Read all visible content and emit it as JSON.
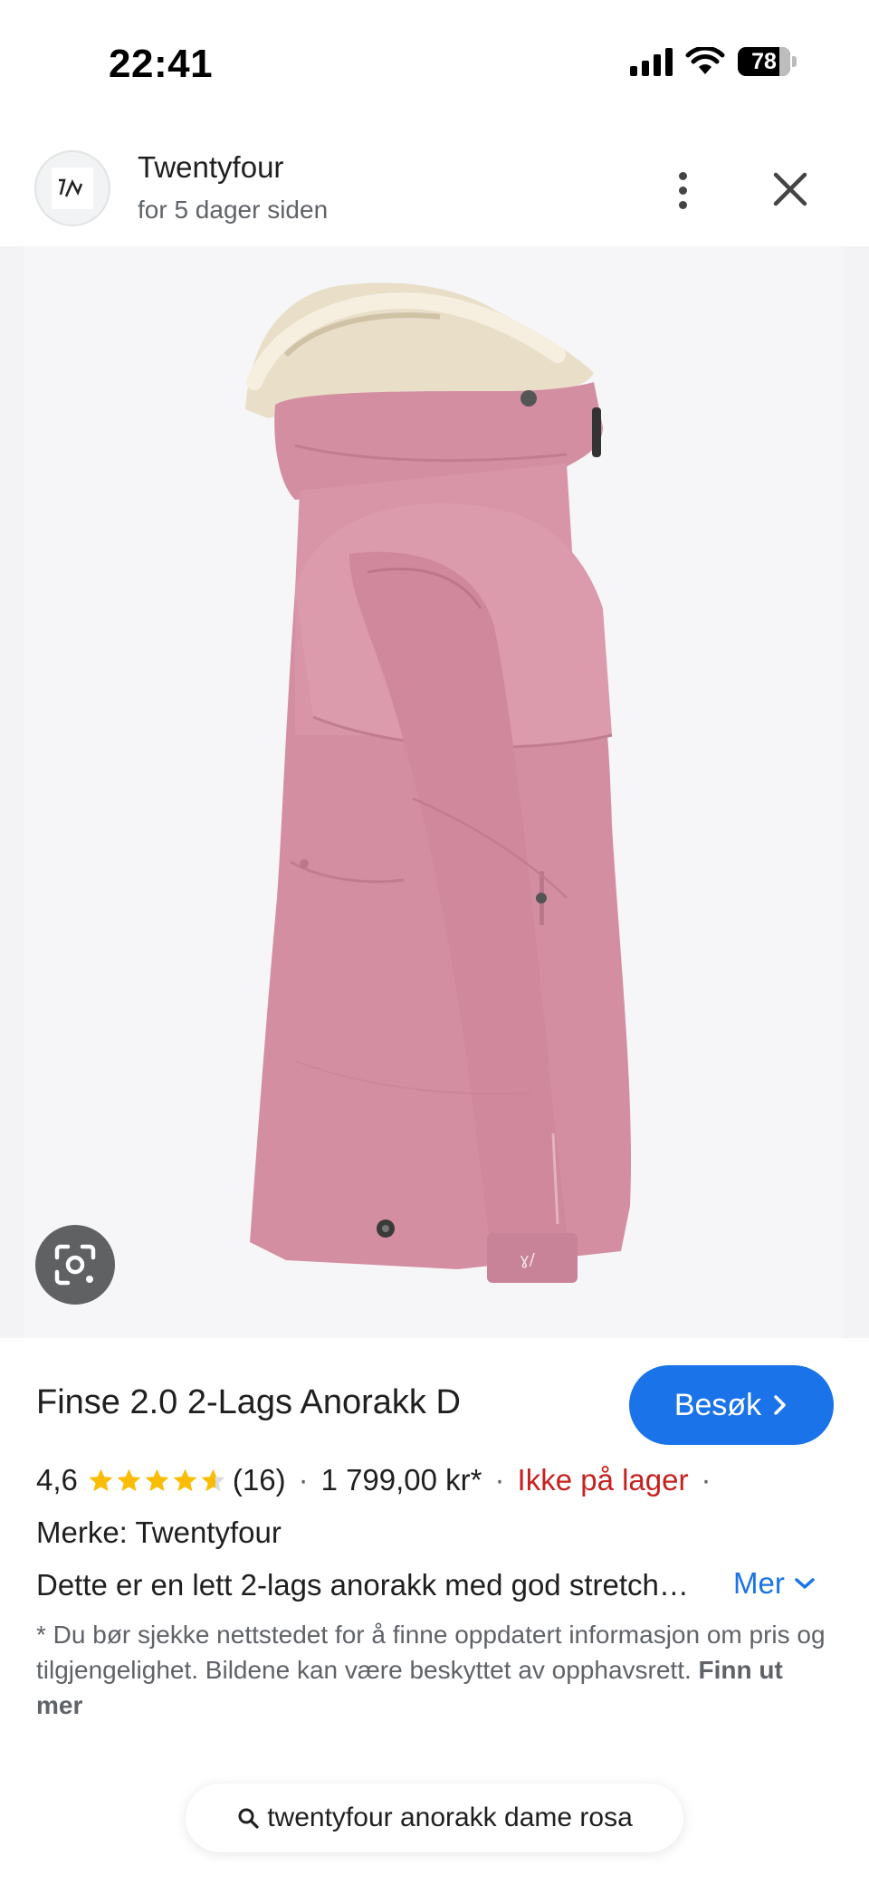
{
  "status_bar": {
    "time": "22:41",
    "battery": "78"
  },
  "source": {
    "name": "Twentyfour",
    "time_ago": "for 5 dager siden"
  },
  "product": {
    "title": "Finse 2.0 2-Lags Anorakk D",
    "rating": "4,6",
    "rating_value": 4.6,
    "review_count": "(16)",
    "price": "1 799,00 kr*",
    "stock_status": "Ikke på lager",
    "brand": "Merke: Twentyfour",
    "description": "Dette er en lett 2-lags anorakk med god stretch…",
    "more_label": "Mer",
    "visit_label": "Besøk",
    "disclaimer": "* Du bør sjekke nettstedet for å finne oppdatert informasjon om pris og tilgjengelighet. Bildene kan være beskyttet av opphavsrett.",
    "disclaimer_link": "Finn ut mer"
  },
  "search_query": "twentyfour anorakk dame rosa",
  "colors": {
    "accent": "#1a73e8",
    "stock_red": "#c5221f",
    "star": "#fbbc04",
    "jacket": "#d98fa4"
  },
  "icons": [
    "signal-icon",
    "wifi-icon",
    "battery-icon",
    "more-vert-icon",
    "close-icon",
    "lens-icon",
    "chevron-right-icon",
    "chevron-down-icon",
    "search-icon",
    "star-icon"
  ]
}
